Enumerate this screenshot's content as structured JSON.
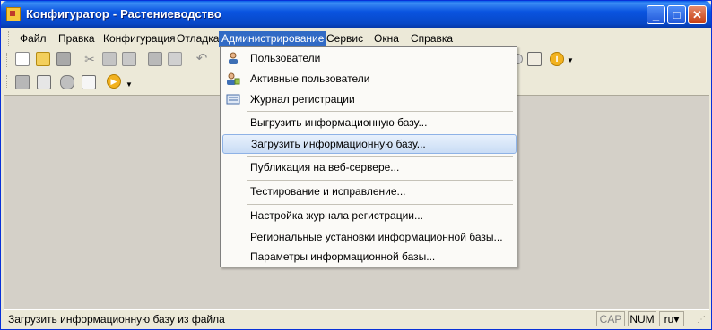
{
  "window": {
    "app_name": "Конфигуратор",
    "separator": "-",
    "document_name": "Растениеводство",
    "minimize_glyph": "_",
    "maximize_glyph": "□",
    "close_glyph": "✕"
  },
  "menubar": {
    "items": [
      "Файл",
      "Правка",
      "Конфигурация",
      "Отладка",
      "Администрирование",
      "Сервис",
      "Окна",
      "Справка"
    ],
    "active": "Администрирование"
  },
  "dropdown": {
    "items": [
      {
        "label": "Пользователи",
        "icon": "users-icon"
      },
      {
        "label": "Активные пользователи",
        "icon": "active-users-icon"
      },
      {
        "label": "Журнал регистрации",
        "icon": "event-log-icon"
      },
      {
        "label": "Выгрузить информационную базу..."
      },
      {
        "label": "Загрузить информационную базу...",
        "highlighted": true
      },
      {
        "label": "Публикация на веб-сервере..."
      },
      {
        "label": "Тестирование и исправление..."
      },
      {
        "label": "Настройка журнала регистрации..."
      },
      {
        "label": "Региональные установки информационной базы..."
      },
      {
        "label": "Параметры информационной базы..."
      }
    ]
  },
  "statusbar": {
    "text": "Загрузить информационную базу из файла",
    "cap": "CAP",
    "num": "NUM",
    "lang": "ru",
    "lang_arrow": "▾"
  },
  "colors": {
    "title_bar": "#0a54e0",
    "menu_active": "#316ac5",
    "work_area": "#d4d0c8",
    "highlight_border": "#8eb2e6"
  }
}
